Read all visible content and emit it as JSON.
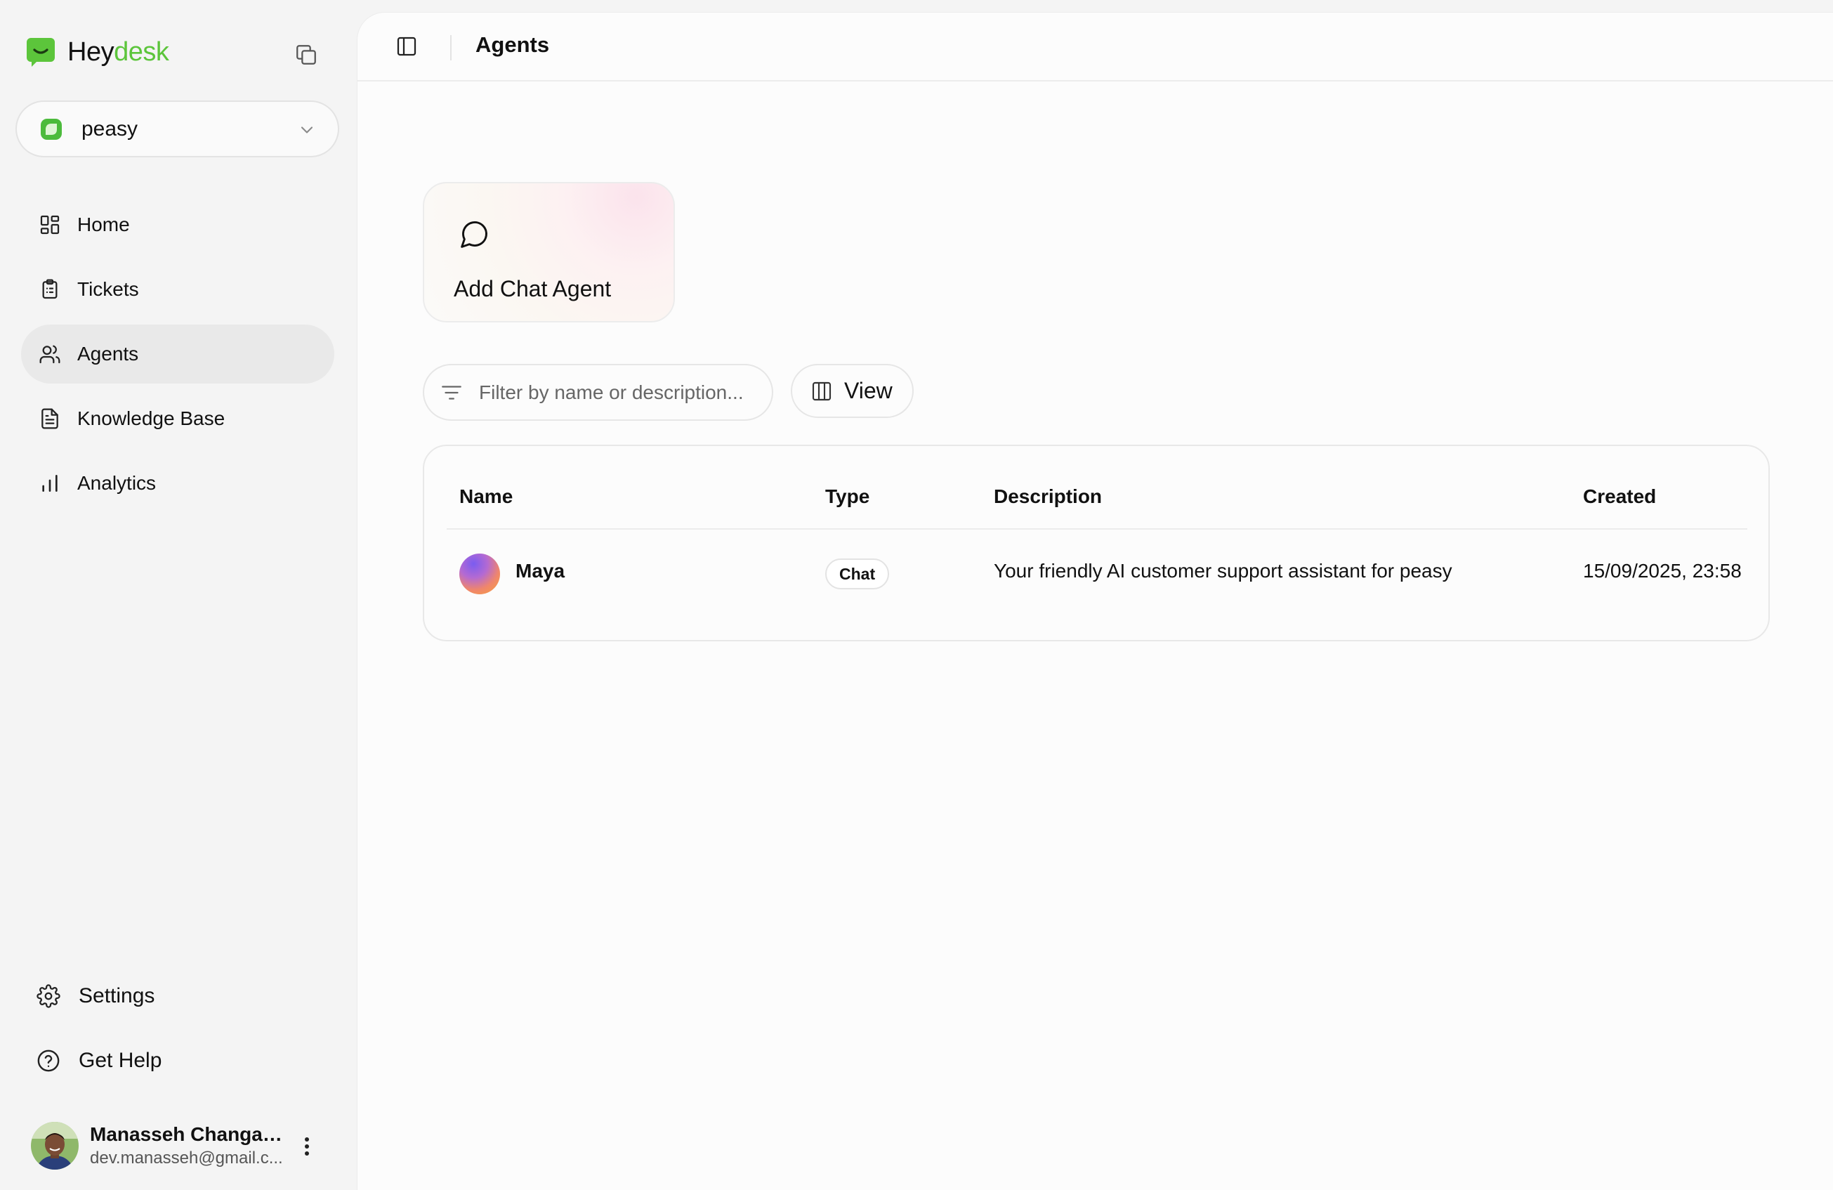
{
  "brand": {
    "name_part1": "Hey",
    "name_part2": "desk",
    "accent_color": "#5cc53b"
  },
  "workspace": {
    "name": "peasy"
  },
  "nav": {
    "items": [
      {
        "label": "Home",
        "icon": "dashboard-icon"
      },
      {
        "label": "Tickets",
        "icon": "clipboard-icon"
      },
      {
        "label": "Agents",
        "icon": "users-icon",
        "active": true
      },
      {
        "label": "Knowledge Base",
        "icon": "document-icon"
      },
      {
        "label": "Analytics",
        "icon": "bar-chart-icon"
      }
    ],
    "bottom": [
      {
        "label": "Settings",
        "icon": "gear-icon"
      },
      {
        "label": "Get Help",
        "icon": "help-circle-icon"
      }
    ]
  },
  "user": {
    "name": "Manasseh Changac...",
    "email": "dev.manasseh@gmail.c..."
  },
  "header": {
    "title": "Agents"
  },
  "add_card": {
    "label": "Add Chat Agent"
  },
  "filter": {
    "placeholder": "Filter by name or description..."
  },
  "view_button": {
    "label": "View"
  },
  "table": {
    "columns": [
      "Name",
      "Type",
      "Description",
      "Created"
    ],
    "rows": [
      {
        "name": "Maya",
        "type": "Chat",
        "description": "Your friendly AI customer support assistant for peasy",
        "created": "15/09/2025, 23:58"
      }
    ]
  }
}
